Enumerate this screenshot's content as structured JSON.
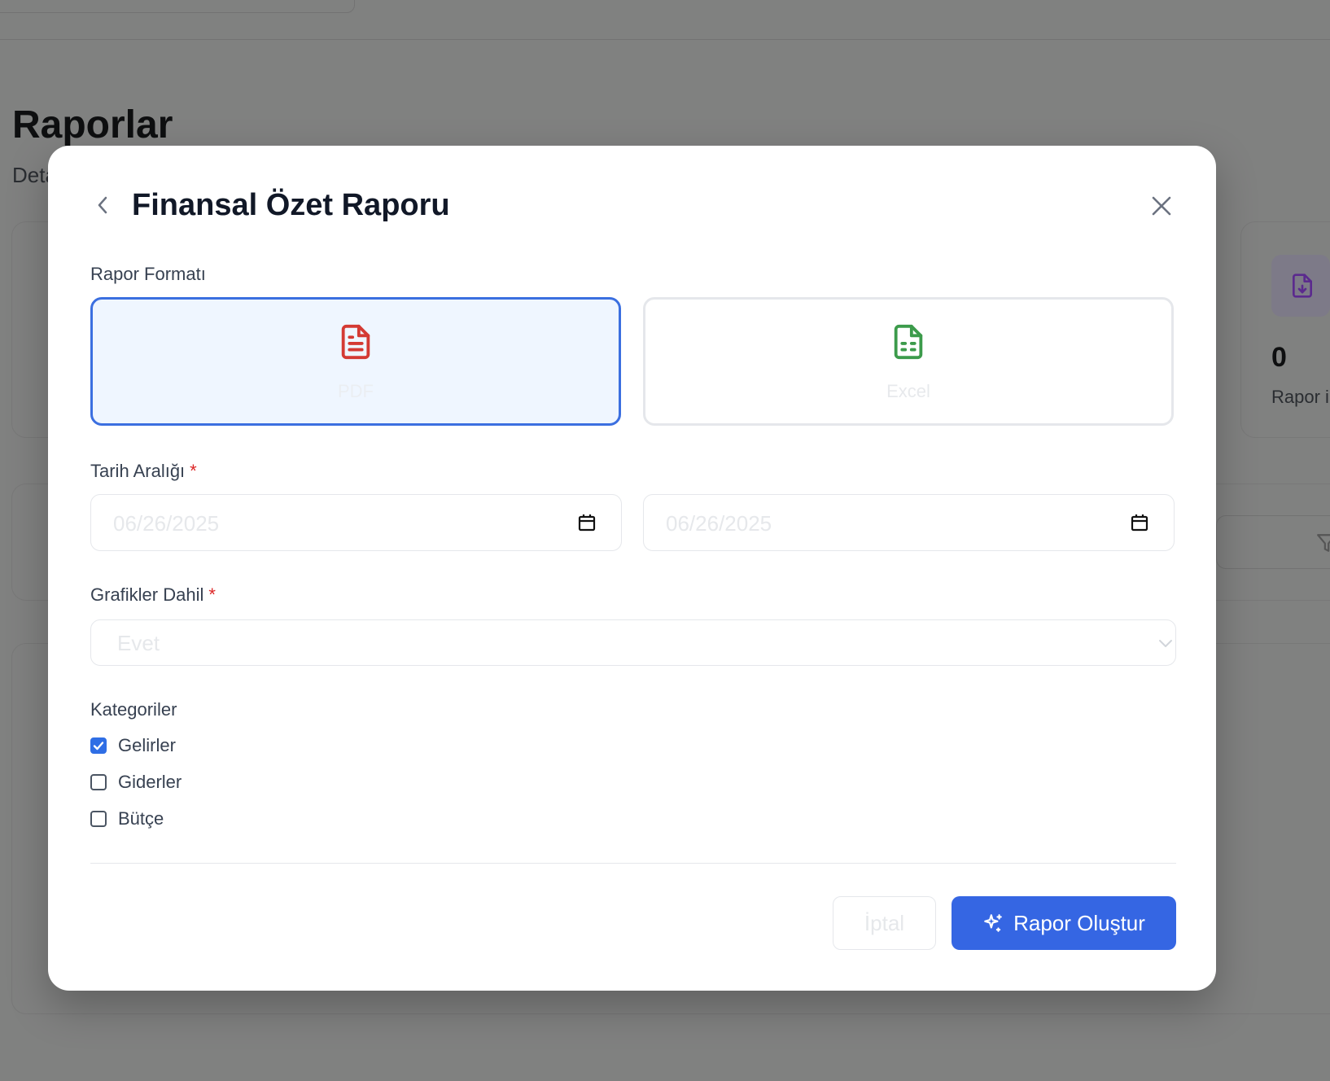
{
  "background": {
    "page_title": "Raporlar",
    "page_subtitle_visible": "Deta",
    "stat_card": {
      "value": "0",
      "label_visible": "Rapor i"
    }
  },
  "modal": {
    "title": "Finansal Özet Raporu",
    "format_section": {
      "label": "Rapor Formatı",
      "options": [
        {
          "label": "PDF",
          "icon": "file-text-icon",
          "color": "#d43a33",
          "selected": true
        },
        {
          "label": "Excel",
          "icon": "file-spreadsheet-icon",
          "color": "#3c9b4b",
          "selected": false
        }
      ]
    },
    "date_range": {
      "label": "Tarih Aralığı",
      "required_mark": "*",
      "start_value": "06/26/2025",
      "end_value": "06/26/2025"
    },
    "charts": {
      "label": "Grafikler Dahil",
      "required_mark": "*",
      "selected": "Evet"
    },
    "categories": {
      "label": "Kategoriler",
      "items": [
        {
          "label": "Gelirler",
          "checked": true
        },
        {
          "label": "Giderler",
          "checked": false
        },
        {
          "label": "Bütçe",
          "checked": false
        }
      ]
    },
    "footer": {
      "cancel_label": "İptal",
      "submit_label": "Rapor Oluştur"
    }
  },
  "colors": {
    "accent": "#3566e3",
    "selected_border": "#3b6fe0",
    "selected_bg": "#eff6ff",
    "required": "#dc2626",
    "overlay": "#808180"
  }
}
